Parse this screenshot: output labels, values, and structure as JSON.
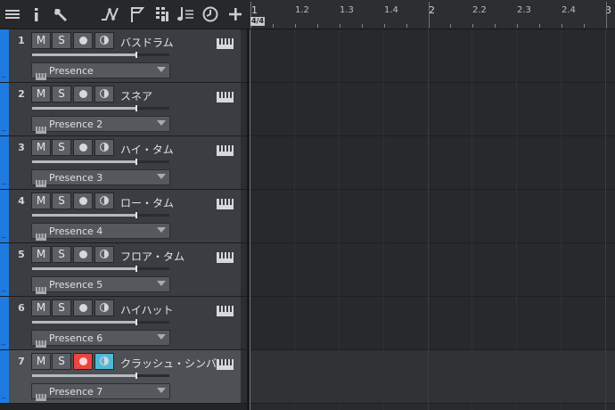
{
  "toolbar": {
    "icons": [
      "hamburger-menu-icon",
      "info-icon",
      "wrench-icon",
      "automation-icon",
      "marker-flag-icon",
      "grid-icon",
      "score-editor-icon",
      "clock-icon",
      "plus-icon"
    ]
  },
  "ruler": {
    "labels": [
      "1",
      "1.2",
      "1.3",
      "1.4",
      "2",
      "2.2",
      "2.3",
      "2.4",
      "3"
    ],
    "time_signature": "4/4"
  },
  "track_buttons": {
    "mute": "M",
    "solo": "S"
  },
  "tracks": [
    {
      "number": "1",
      "name": "バスドラム",
      "instrument": "Presence",
      "volume": 0.76,
      "record_armed": false,
      "monitor": false,
      "selected": false
    },
    {
      "number": "2",
      "name": "スネア",
      "instrument": "Presence 2",
      "volume": 0.76,
      "record_armed": false,
      "monitor": false,
      "selected": false
    },
    {
      "number": "3",
      "name": "ハイ・タム",
      "instrument": "Presence 3",
      "volume": 0.76,
      "record_armed": false,
      "monitor": false,
      "selected": false
    },
    {
      "number": "4",
      "name": "ロー・タム",
      "instrument": "Presence 4",
      "volume": 0.76,
      "record_armed": false,
      "monitor": false,
      "selected": false
    },
    {
      "number": "5",
      "name": "フロア・タム",
      "instrument": "Presence 5",
      "volume": 0.76,
      "record_armed": false,
      "monitor": false,
      "selected": false
    },
    {
      "number": "6",
      "name": "ハイハット",
      "instrument": "Presence 6",
      "volume": 0.76,
      "record_armed": false,
      "monitor": false,
      "selected": false
    },
    {
      "number": "7",
      "name": "クラッシュ・シンバル",
      "instrument": "Presence 7",
      "volume": 0.76,
      "record_armed": true,
      "monitor": true,
      "selected": true
    }
  ],
  "colors": {
    "track_strip": "#1f7be0",
    "record_active": "#e8463f",
    "monitor_active": "#4fb8d8"
  }
}
